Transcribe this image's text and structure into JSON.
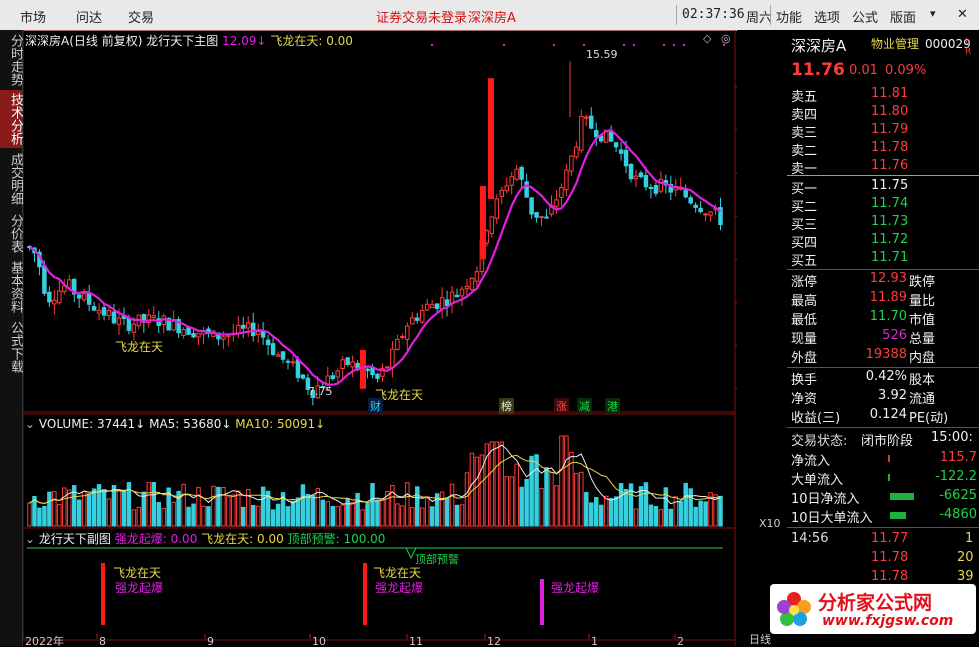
{
  "topbar": {
    "menu_left": [
      "市场",
      "问达",
      "交易"
    ],
    "notice": "证券交易未登录",
    "stock_short": "深深房A",
    "time": "02:37:36",
    "weekday": "周六",
    "menu_right": [
      "功能",
      "选项",
      "公式",
      "版面"
    ],
    "min": "▾",
    "close": "✕"
  },
  "tabs": [
    {
      "label": "分时走势",
      "active": false
    },
    {
      "label": "技术分析",
      "active": true
    },
    {
      "label": "成交明细",
      "active": false
    },
    {
      "label": "分价表",
      "active": false
    },
    {
      "label": "基本资料",
      "active": false
    },
    {
      "label": "公式下载",
      "active": false
    }
  ],
  "main_chart": {
    "title": "深深房A(日线 前复权)",
    "indicator": "龙行天下主图",
    "indicator_value": "12.09",
    "feilong_label": "飞龙在天:",
    "feilong_value": "0.00",
    "high_label": "15.59",
    "low_label": "7.75",
    "signal_text": "飞龙在天",
    "event_labels": [
      "财",
      "榜",
      "涨",
      "减",
      "港"
    ],
    "y_ticks": [
      "15.00",
      "14.00",
      "13.00",
      "12.00",
      "11.00",
      "10.00",
      "9.00",
      "8.00"
    ],
    "y_min": 7.6,
    "y_max": 15.9
  },
  "volume_chart": {
    "vol_label": "VOLUME:",
    "vol_value": "37441",
    "ma5_label": "MA5:",
    "ma5_value": "53680",
    "ma10_label": "MA10:",
    "ma10_value": "50091",
    "y_ticks": [
      "45000",
      "30000",
      "15000"
    ],
    "unit": "X10"
  },
  "sub_chart": {
    "title": "龙行天下副图",
    "qilong_label": "强龙起爆:",
    "qilong_value": "0.00",
    "feilong_label": "飞龙在天:",
    "feilong_value": "0.00",
    "dingbu_label": "顶部预警:",
    "dingbu_value": "100.00",
    "dingbu_marker": "顶部预警",
    "y_ticks": [
      "100.0",
      "75.0",
      "50.0",
      "25.0"
    ],
    "signal_feilong": "飞龙在天",
    "signal_qilong": "强龙起爆"
  },
  "x_axis": {
    "labels": [
      "2022年",
      "8",
      "9",
      "10",
      "11",
      "12",
      "1",
      "2"
    ],
    "corner": "日线"
  },
  "right_panel": {
    "name": "深深房A",
    "sector": "物业管理",
    "code": "000029",
    "flags": "L R",
    "price": "11.76",
    "change": "0.01",
    "change_pct": "0.09%",
    "asks": [
      {
        "label": "卖五",
        "price": "11.81"
      },
      {
        "label": "卖四",
        "price": "11.80"
      },
      {
        "label": "卖三",
        "price": "11.79"
      },
      {
        "label": "卖二",
        "price": "11.78"
      },
      {
        "label": "卖一",
        "price": "11.76"
      }
    ],
    "bids": [
      {
        "label": "买一",
        "price": "11.75"
      },
      {
        "label": "买二",
        "price": "11.74"
      },
      {
        "label": "买三",
        "price": "11.73"
      },
      {
        "label": "买四",
        "price": "11.72"
      },
      {
        "label": "买五",
        "price": "11.71"
      }
    ],
    "stats": [
      {
        "l1": "涨停",
        "v1": "12.93",
        "l2": "跌停"
      },
      {
        "l1": "最高",
        "v1": "11.89",
        "l2": "量比"
      },
      {
        "l1": "最低",
        "v1": "11.70",
        "l2": "市值"
      },
      {
        "l1": "现量",
        "v1": "526",
        "l2": "总量"
      },
      {
        "l1": "外盘",
        "v1": "19388",
        "l2": "内盘"
      }
    ],
    "stats2": [
      {
        "l1": "换手",
        "v1": "0.42%",
        "l2": "股本"
      },
      {
        "l1": "净资",
        "v1": "3.92",
        "l2": "流通"
      },
      {
        "l1": "收益(三)",
        "v1": "0.124",
        "l2": "PE(动)"
      }
    ],
    "status_label": "交易状态:",
    "status_value": "闭市阶段",
    "status_time": "15:00:",
    "flows": [
      {
        "label": "净流入",
        "value": "115.7"
      },
      {
        "label": "大单流入",
        "value": "-122.2"
      },
      {
        "label": "10日净流入",
        "value": "-6625"
      },
      {
        "label": "10日大单流入",
        "value": "-4860"
      }
    ],
    "tick_time": "14:56",
    "ticks": [
      {
        "price": "11.77",
        "vol": "1"
      },
      {
        "price": "11.78",
        "vol": "20"
      },
      {
        "price": "11.78",
        "vol": "39"
      }
    ]
  },
  "watermark": {
    "brand": "分析家公式网",
    "url": "www.fxjgsw.com"
  },
  "colors": {
    "up": "#ff3b3b",
    "down": "#35d0e0",
    "ma": "#e020e0",
    "grid": "#7a1111"
  }
}
